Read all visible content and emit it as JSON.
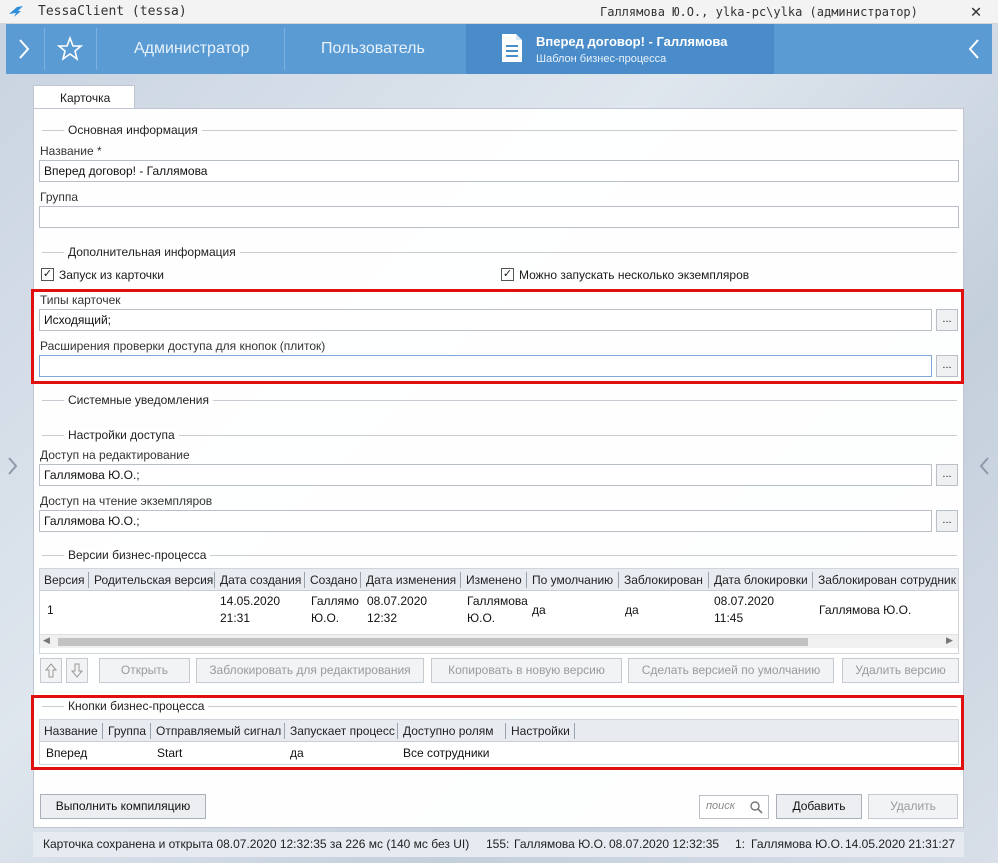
{
  "window": {
    "title": "TessaClient (tessa)",
    "user_info": "Галлямова Ю.О., ylka-pc\\ylka (администратор)",
    "close_glyph": "✕"
  },
  "topbar": {
    "tab_admin": "Администратор",
    "tab_user": "Пользователь",
    "active_title": "Вперед договор! - Галлямова",
    "active_subtitle": "Шаблон бизнес-процесса"
  },
  "card_tab": "Карточка",
  "main_info": {
    "section": "Основная информация",
    "name_label": "Название",
    "required_mark": "*",
    "name_value": "Вперед договор! - Галлямова",
    "group_label": "Группа",
    "group_value": ""
  },
  "extra_info": {
    "section": "Дополнительная информация",
    "start_from_card": "Запуск из карточки",
    "multiple_instances": "Можно запускать несколько экземпляров",
    "card_types_label": "Типы карточек",
    "card_types_value": "Исходящий;",
    "access_ext_label": "Расширения проверки доступа для кнопок (плиток)",
    "access_ext_value": "",
    "dots": "..."
  },
  "system_notifications": "Системные уведомления",
  "access": {
    "section": "Настройки доступа",
    "edit_label": "Доступ на редактирование",
    "edit_value": "Галлямова Ю.О.;",
    "read_label": "Доступ на чтение экземпляров",
    "read_value": "Галлямова Ю.О.;"
  },
  "versions": {
    "section": "Версии бизнес-процесса",
    "columns": [
      "Версия",
      "Родительская версия",
      "Дата создания",
      "Создано",
      "Дата изменения",
      "Изменено",
      "По умолчанию",
      "Заблокирован",
      "Дата блокировки",
      "Заблокирован сотрудник"
    ],
    "row": {
      "version": "1",
      "parent": "",
      "created_date": "14.05.2020",
      "created_time": "21:31",
      "created_by_1": "Галлямо",
      "created_by_2": "Ю.О.",
      "modified_date": "08.07.2020",
      "modified_time": "12:32",
      "modified_by_1": "Галлямова",
      "modified_by_2": "Ю.О.",
      "is_default": "да",
      "locked": "да",
      "lock_date": "08.07.2020",
      "lock_time": "11:45",
      "locked_by": "Галлямова Ю.О."
    },
    "buttons": {
      "open": "Открыть",
      "lock": "Заблокировать для редактирования",
      "copy": "Копировать в новую версию",
      "make_default": "Сделать версией по умолчанию",
      "delete": "Удалить версию"
    }
  },
  "bp_buttons": {
    "section": "Кнопки бизнес-процесса",
    "columns": [
      "Название",
      "Группа",
      "Отправляемый сигнал",
      "Запускает процесс",
      "Доступно ролям",
      "Настройки"
    ],
    "row": {
      "name": "Вперед",
      "group": "",
      "signal": "Start",
      "starts_process": "да",
      "roles": "Все сотрудники",
      "settings": ""
    }
  },
  "bottom": {
    "compile": "Выполнить компиляцию",
    "search_placeholder": "поиск",
    "add": "Добавить",
    "remove": "Удалить"
  },
  "status": {
    "saved": "Карточка сохранена и открыта 08.07.2020 12:32:35 за 226 мс (140 мс без UI)",
    "rev_num": "155:",
    "rev_user": "Галлямова Ю.О.",
    "rev_date": "08.07.2020 12:32:35",
    "first_num": "1:",
    "first_user": "Галлямова Ю.О.",
    "first_date": "14.05.2020 21:31:27"
  },
  "colors": {
    "accent": "#5b9bd4",
    "active_tab": "#4a8cca",
    "highlight": "#e01010"
  }
}
